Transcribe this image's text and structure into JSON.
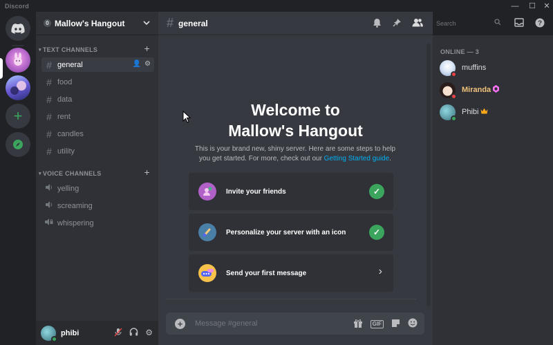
{
  "titlebar": {
    "brand": "Discord",
    "min": "—",
    "max": "☐",
    "close": "✕"
  },
  "rail": {
    "home_icon": "discord-logo",
    "add_icon": "+",
    "explore_icon": "compass"
  },
  "guild": {
    "boost_count": "0",
    "name": "Mallow's Hangout",
    "chevron": "⌄"
  },
  "text_channels": {
    "label": "TEXT CHANNELS",
    "items": [
      "general",
      "food",
      "data",
      "rent",
      "candles",
      "utility"
    ]
  },
  "voice_channels": {
    "label": "VOICE CHANNELS",
    "items": [
      "yelling",
      "screaming",
      "whispering"
    ]
  },
  "user": {
    "name": "phibi"
  },
  "header": {
    "channel": "general"
  },
  "search": {
    "placeholder": "Search"
  },
  "welcome": {
    "title_line1": "Welcome to",
    "title_line2": "Mallow's Hangout",
    "sub": "This is your brand new, shiny server. Here are some steps to help you get started. For more, check out our ",
    "link": "Getting Started guide",
    "period": "."
  },
  "cards": [
    {
      "label": "Invite your friends",
      "done": true
    },
    {
      "label": "Personalize your server with an icon",
      "done": true
    },
    {
      "label": "Send your first message",
      "done": false
    }
  ],
  "composer": {
    "placeholder": "Message #general",
    "gif": "GIF"
  },
  "members": {
    "label": "ONLINE — 3",
    "list": [
      {
        "name": "muffins",
        "color": "#dcddde",
        "status": "dnd"
      },
      {
        "name": "Miranda",
        "color": "#f0c27b",
        "status": "dnd"
      },
      {
        "name": "Phibi",
        "color": "#dcddde",
        "status": "online"
      }
    ]
  },
  "colors": {
    "accent": "#5865f2",
    "success": "#3ba55d",
    "link": "#00b0f4"
  }
}
